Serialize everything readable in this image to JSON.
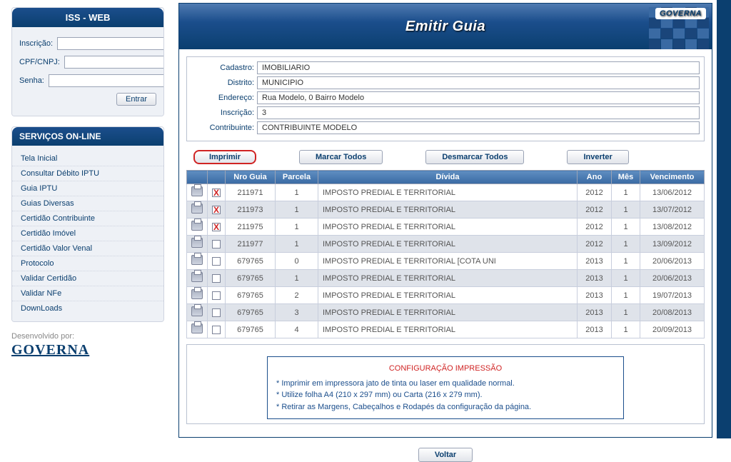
{
  "sidebar": {
    "title": "ISS - WEB",
    "login": {
      "inscricao_label": "Inscrição:",
      "cpf_label": "CPF/CNPJ:",
      "senha_label": "Senha:",
      "entrar": "Entrar"
    },
    "services": {
      "header": "SERVIÇOS ON-LINE",
      "items": [
        {
          "label": "Tela Inicial"
        },
        {
          "label": "Consultar Débito IPTU"
        },
        {
          "label": "Guia IPTU"
        },
        {
          "label": "Guias Diversas"
        },
        {
          "label": "Certidão Contribuinte"
        },
        {
          "label": "Certidão Imóvel"
        },
        {
          "label": "Certidão Valor Venal"
        },
        {
          "label": "Protocolo"
        },
        {
          "label": "Validar Certidão"
        },
        {
          "label": "Validar NFe"
        },
        {
          "label": "DownLoads"
        }
      ]
    },
    "devby": "Desenvolvido por:",
    "logo": "GOVERNA"
  },
  "main": {
    "title": "Emitir Guia",
    "logo": "GOVERNA",
    "form": {
      "cadastro_label": "Cadastro:",
      "cadastro_value": "IMOBILIARIO",
      "distrito_label": "Distrito:",
      "distrito_value": "MUNICIPIO",
      "endereco_label": "Endereço:",
      "endereco_value": "Rua Modelo, 0 Bairro Modelo",
      "inscricao_label": "Inscrição:",
      "inscricao_value": "3",
      "contribuinte_label": "Contribuinte:",
      "contribuinte_value": "CONTRIBUINTE MODELO"
    },
    "actions": {
      "imprimir": "Imprimir",
      "marcar_todos": "Marcar Todos",
      "desmarcar_todos": "Desmarcar Todos",
      "inverter": "Inverter"
    },
    "columns": {
      "c0": "",
      "c1": "",
      "nro_guia": "Nro Guia",
      "parcela": "Parcela",
      "divida": "Dívida",
      "ano": "Ano",
      "mes": "Mês",
      "vencimento": "Vencimento"
    },
    "rows": [
      {
        "checked": true,
        "nro": "211971",
        "parc": "1",
        "divida": "IMPOSTO PREDIAL E TERRITORIAL",
        "ano": "2012",
        "mes": "1",
        "venc": "13/06/2012",
        "alt": false
      },
      {
        "checked": true,
        "nro": "211973",
        "parc": "1",
        "divida": "IMPOSTO PREDIAL E TERRITORIAL",
        "ano": "2012",
        "mes": "1",
        "venc": "13/07/2012",
        "alt": true
      },
      {
        "checked": true,
        "nro": "211975",
        "parc": "1",
        "divida": "IMPOSTO PREDIAL E TERRITORIAL",
        "ano": "2012",
        "mes": "1",
        "venc": "13/08/2012",
        "alt": false
      },
      {
        "checked": false,
        "nro": "211977",
        "parc": "1",
        "divida": "IMPOSTO PREDIAL E TERRITORIAL",
        "ano": "2012",
        "mes": "1",
        "venc": "13/09/2012",
        "alt": true
      },
      {
        "checked": false,
        "nro": "679765",
        "parc": "0",
        "divida": "IMPOSTO PREDIAL E TERRITORIAL [COTA UNI",
        "ano": "2013",
        "mes": "1",
        "venc": "20/06/2013",
        "alt": false
      },
      {
        "checked": false,
        "nro": "679765",
        "parc": "1",
        "divida": "IMPOSTO PREDIAL E TERRITORIAL",
        "ano": "2013",
        "mes": "1",
        "venc": "20/06/2013",
        "alt": true
      },
      {
        "checked": false,
        "nro": "679765",
        "parc": "2",
        "divida": "IMPOSTO PREDIAL E TERRITORIAL",
        "ano": "2013",
        "mes": "1",
        "venc": "19/07/2013",
        "alt": false
      },
      {
        "checked": false,
        "nro": "679765",
        "parc": "3",
        "divida": "IMPOSTO PREDIAL E TERRITORIAL",
        "ano": "2013",
        "mes": "1",
        "venc": "20/08/2013",
        "alt": true
      },
      {
        "checked": false,
        "nro": "679765",
        "parc": "4",
        "divida": "IMPOSTO PREDIAL E TERRITORIAL",
        "ano": "2013",
        "mes": "1",
        "venc": "20/09/2013",
        "alt": false
      }
    ],
    "config": {
      "title": "CONFIGURAÇÃO IMPRESSÃO",
      "line1": "* Imprimir em impressora jato de tinta ou laser em qualidade normal.",
      "line2": "* Utilize folha A4 (210 x 297 mm) ou Carta (216 x 279 mm).",
      "line3": "* Retirar as Margens, Cabeçalhos e Rodapés da configuração da página."
    },
    "voltar": "Voltar"
  }
}
